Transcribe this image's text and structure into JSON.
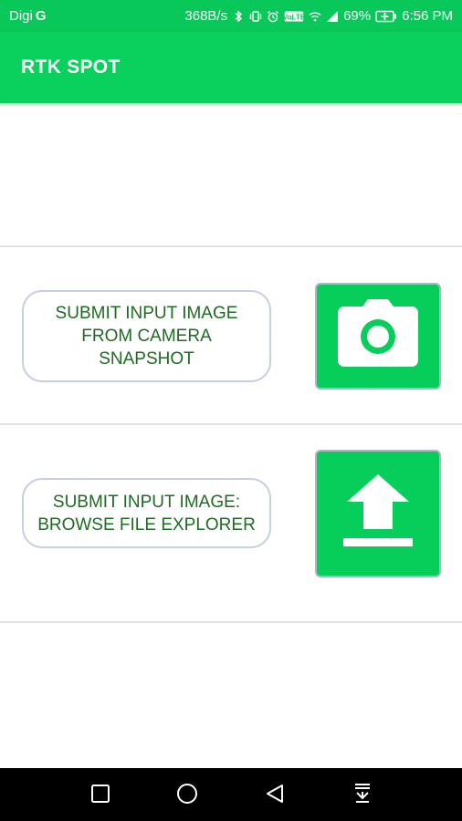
{
  "status_bar": {
    "carrier": "Digi",
    "network_letter": "G",
    "speed": "368B/s",
    "signal_label": "VoLTE",
    "battery": "69%",
    "time": "6:56 PM",
    "icons": [
      "bluetooth-icon",
      "vibrate-icon",
      "alarm-icon",
      "volte-icon",
      "wifi-icon",
      "signal-icon",
      "battery-charging-icon"
    ]
  },
  "app_bar": {
    "title": "RTK SPOT",
    "color": "#0ad05d"
  },
  "actions": {
    "camera": {
      "label": "SUBMIT INPUT IMAGE FROM CAMERA SNAPSHOT",
      "icon": "camera-icon"
    },
    "browse": {
      "label": "SUBMIT INPUT IMAGE: BROWSE FILE EXPLORER",
      "icon": "upload-icon"
    }
  },
  "nav_bar": {
    "buttons": [
      "recents-button",
      "home-button",
      "back-button",
      "notifications-pull-down-button"
    ]
  },
  "colors": {
    "accent": "#07cd5b",
    "label_text": "#1f6b22",
    "button_border": "#c7cde4"
  }
}
